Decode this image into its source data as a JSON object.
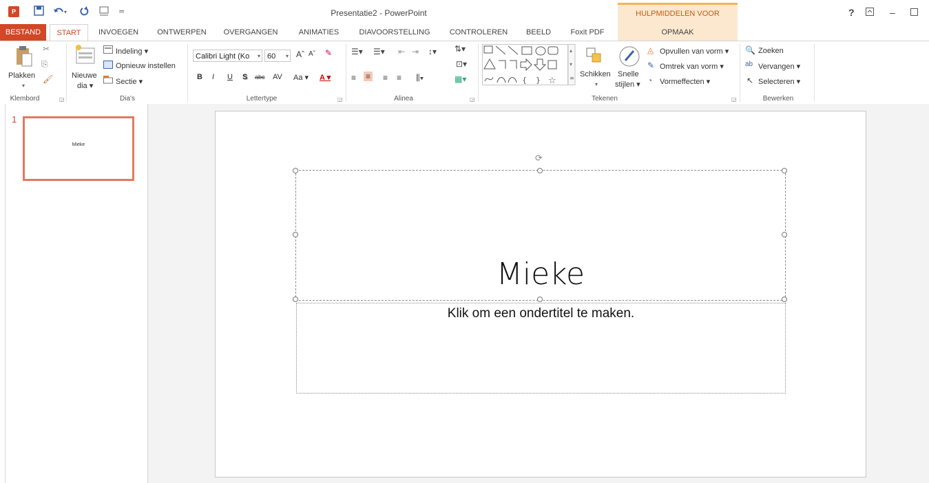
{
  "titlebar": {
    "doc_title": "Presentatie2 - PowerPoint",
    "contextual_group": "HULPMIDDELEN VOOR TEKENEN",
    "help": "?",
    "window_controls": [
      "?",
      "▣",
      "–",
      "☐"
    ],
    "app_icon_text": "P"
  },
  "tabs": {
    "file": "BESTAND",
    "start": "START",
    "invoegen": "INVOEGEN",
    "ontwerpen": "ONTWERPEN",
    "overgangen": "OVERGANGEN",
    "animaties": "ANIMATIES",
    "diavoorstelling": "DIAVOORSTELLING",
    "controleren": "CONTROLEREN",
    "beeld": "BEELD",
    "foxit": "Foxit PDF",
    "opmaak": "OPMAAK"
  },
  "ribbon": {
    "klembord": {
      "label": "Klembord",
      "plakken": "Plakken"
    },
    "dias": {
      "label": "Dia's",
      "nieuwe": "Nieuwe",
      "dia": "dia ▾",
      "indeling": "Indeling ▾",
      "opnieuw": "Opnieuw instellen",
      "sectie": "Sectie ▾"
    },
    "lettertype": {
      "label": "Lettertype",
      "font_name": "Calibri Light (Ko",
      "font_size": "60",
      "bold": "B",
      "italic": "I",
      "underline": "U",
      "shadow": "S",
      "strike": "abc",
      "spacing": "AV",
      "case": "Aa ▾",
      "color": "A ▾",
      "grow": "Aˆ",
      "shrink": "Aˇ"
    },
    "alinea": {
      "label": "Alinea"
    },
    "tekenen": {
      "label": "Tekenen",
      "schikken": "Schikken",
      "snelle": "Snelle",
      "stijlen": "stijlen ▾",
      "opvullen": "Opvullen van vorm ▾",
      "omtrek": "Omtrek van vorm ▾",
      "vormeffecten": "Vormeffecten ▾"
    },
    "bewerken": {
      "label": "Bewerken",
      "zoeken": "Zoeken",
      "vervangen": "Vervangen ▾",
      "selecteren": "Selecteren ▾"
    }
  },
  "thumbnails": [
    {
      "number": "1",
      "title": "Mieke"
    }
  ],
  "slide": {
    "title": "Mieke",
    "subtitle": "Klik om een ondertitel te maken."
  },
  "colors": {
    "accent": "#d24726",
    "contextual": "#fbe8cf",
    "selection_border": "#e0795e"
  }
}
